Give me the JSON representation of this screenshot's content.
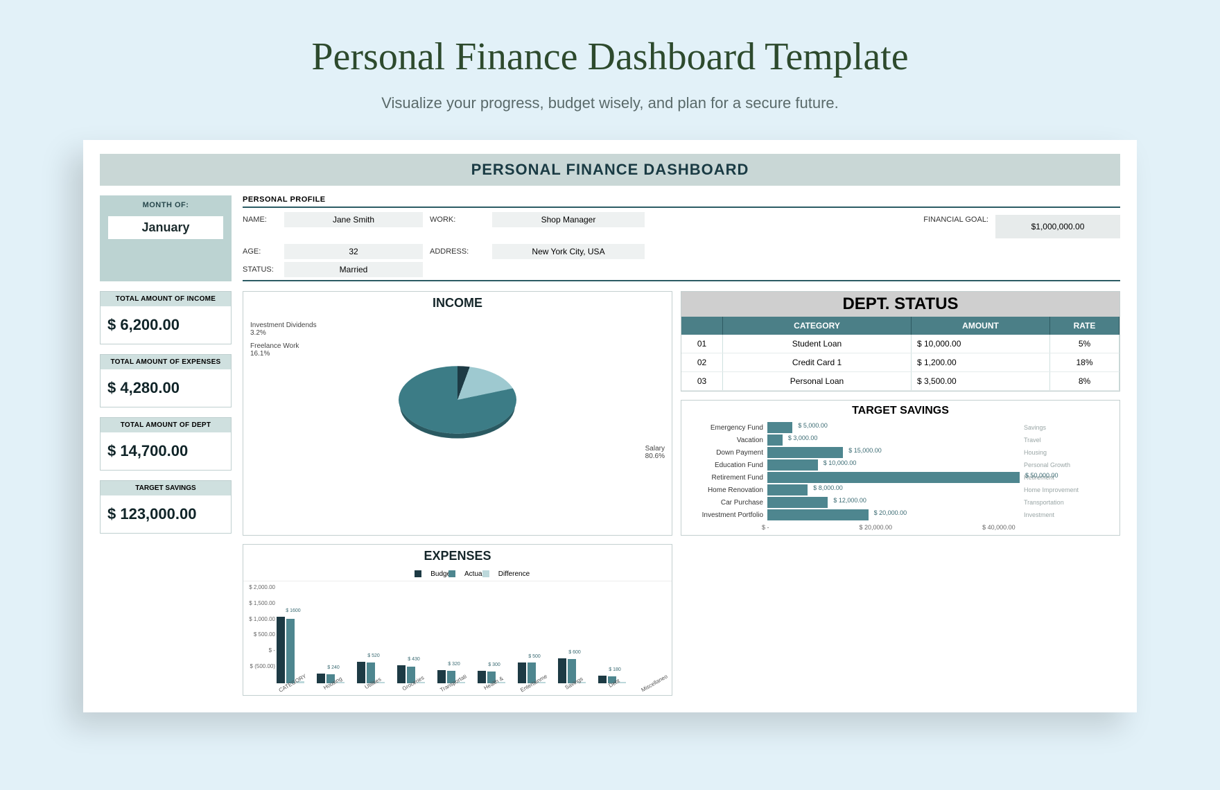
{
  "header": {
    "title": "Personal Finance Dashboard Template",
    "subtitle": "Visualize your progress, budget wisely, and plan for a secure future."
  },
  "banner": "PERSONAL FINANCE DASHBOARD",
  "month": {
    "label": "MONTH OF:",
    "value": "January"
  },
  "profile": {
    "section": "PERSONAL PROFILE",
    "name_label": "NAME:",
    "name": "Jane Smith",
    "age_label": "AGE:",
    "age": "32",
    "status_label": "STATUS:",
    "status": "Married",
    "work_label": "WORK:",
    "work": "Shop Manager",
    "address_label": "ADDRESS:",
    "address": "New York City, USA",
    "goal_label": "FINANCIAL GOAL:",
    "goal": "$1,000,000.00"
  },
  "kpi": {
    "income_label": "TOTAL AMOUNT OF INCOME",
    "income": "$   6,200.00",
    "expenses_label": "TOTAL AMOUNT OF EXPENSES",
    "expenses": "$   4,280.00",
    "debt_label": "TOTAL AMOUNT OF DEPT",
    "debt": "$ 14,700.00",
    "savings_label": "TARGET SAVINGS",
    "savings": "$ 123,000.00"
  },
  "income_chart": {
    "title": "INCOME",
    "lbl_div": "Investment Dividends",
    "pct_div": "3.2%",
    "lbl_fw": "Freelance Work",
    "pct_fw": "16.1%",
    "lbl_sal": "Salary",
    "pct_sal": "80.6%"
  },
  "dept": {
    "title": "DEPT. STATUS",
    "h_cat": "CATEGORY",
    "h_amt": "AMOUNT",
    "h_rate": "RATE",
    "rows": [
      {
        "id": "01",
        "cat": "Student Loan",
        "amt": "$                       10,000.00",
        "rate": "5%"
      },
      {
        "id": "02",
        "cat": "Credit Card 1",
        "amt": "$                         1,200.00",
        "rate": "18%"
      },
      {
        "id": "03",
        "cat": "Personal Loan",
        "amt": "$                         3,500.00",
        "rate": "8%"
      }
    ]
  },
  "expenses_chart": {
    "title": "EXPENSES",
    "legend": {
      "b": "Budget",
      "a": "Actual",
      "d": "Difference"
    },
    "yticks": [
      "$ 2,000.00",
      "$ 1,500.00",
      "$ 1,000.00",
      "$ 500.00",
      "$ -",
      "$ (500.00)"
    ],
    "cats": [
      "CATEGORY",
      "Housing",
      "Utilities",
      "Groceries",
      "Transportati",
      "Health &",
      "Entertainme",
      "Savings",
      "Debt",
      "Miscellaneo"
    ]
  },
  "target": {
    "title": "TARGET SAVINGS",
    "rows": [
      {
        "name": "Emergency Fund",
        "val": "$ 5,000.00",
        "pct": 10,
        "note": "Savings"
      },
      {
        "name": "Vacation",
        "val": "$ 3,000.00",
        "pct": 6,
        "note": "Travel"
      },
      {
        "name": "Down Payment",
        "val": "$ 15,000.00",
        "pct": 30,
        "note": "Housing"
      },
      {
        "name": "Education Fund",
        "val": "$ 10,000.00",
        "pct": 20,
        "note": "Personal Growth"
      },
      {
        "name": "Retirement Fund",
        "val": "$ 50,000.00",
        "pct": 100,
        "note": "Retirement"
      },
      {
        "name": "Home Renovation",
        "val": "$ 8,000.00",
        "pct": 16,
        "note": "Home Improvement"
      },
      {
        "name": "Car Purchase",
        "val": "$ 12,000.00",
        "pct": 24,
        "note": "Transportation"
      },
      {
        "name": "Investment Portfolio",
        "val": "$ 20,000.00",
        "pct": 40,
        "note": "Investment"
      }
    ],
    "axis": [
      "$ -",
      "$ 20,000.00",
      "$ 40,000.00"
    ]
  },
  "chart_data": [
    {
      "type": "pie",
      "title": "INCOME",
      "series": [
        {
          "name": "Salary",
          "value": 80.6
        },
        {
          "name": "Freelance Work",
          "value": 16.1
        },
        {
          "name": "Investment Dividends",
          "value": 3.2
        }
      ],
      "total": 6200
    },
    {
      "type": "bar",
      "title": "EXPENSES",
      "categories": [
        "Housing",
        "Utilities",
        "Groceries",
        "Transportation",
        "Health & Wellness",
        "Entertainment",
        "Savings",
        "Debt",
        "Miscellaneous"
      ],
      "series": [
        {
          "name": "Budget",
          "values": [
            1600,
            240,
            520,
            430,
            320,
            300,
            500,
            600,
            180
          ]
        },
        {
          "name": "Actual",
          "values": [
            1550,
            210,
            500,
            400,
            300,
            280,
            500,
            580,
            160
          ]
        },
        {
          "name": "Difference",
          "values": [
            50,
            30,
            20,
            30,
            20,
            20,
            0,
            20,
            20
          ]
        }
      ],
      "ylabel": "$",
      "ylim": [
        -500,
        2000
      ]
    },
    {
      "type": "table",
      "title": "DEPT. STATUS",
      "columns": [
        "CATEGORY",
        "AMOUNT",
        "RATE"
      ],
      "rows": [
        [
          "Student Loan",
          10000,
          "5%"
        ],
        [
          "Credit Card 1",
          1200,
          "18%"
        ],
        [
          "Personal Loan",
          3500,
          "8%"
        ]
      ]
    },
    {
      "type": "bar",
      "orientation": "horizontal",
      "title": "TARGET SAVINGS",
      "categories": [
        "Emergency Fund",
        "Vacation",
        "Down Payment",
        "Education Fund",
        "Retirement Fund",
        "Home Renovation",
        "Car Purchase",
        "Investment Portfolio"
      ],
      "values": [
        5000,
        3000,
        15000,
        10000,
        50000,
        8000,
        12000,
        20000
      ],
      "notes": [
        "Savings",
        "Travel",
        "Housing",
        "Personal Growth",
        "Retirement",
        "Home Improvement",
        "Transportation",
        "Investment"
      ],
      "xlim": [
        0,
        50000
      ]
    }
  ]
}
